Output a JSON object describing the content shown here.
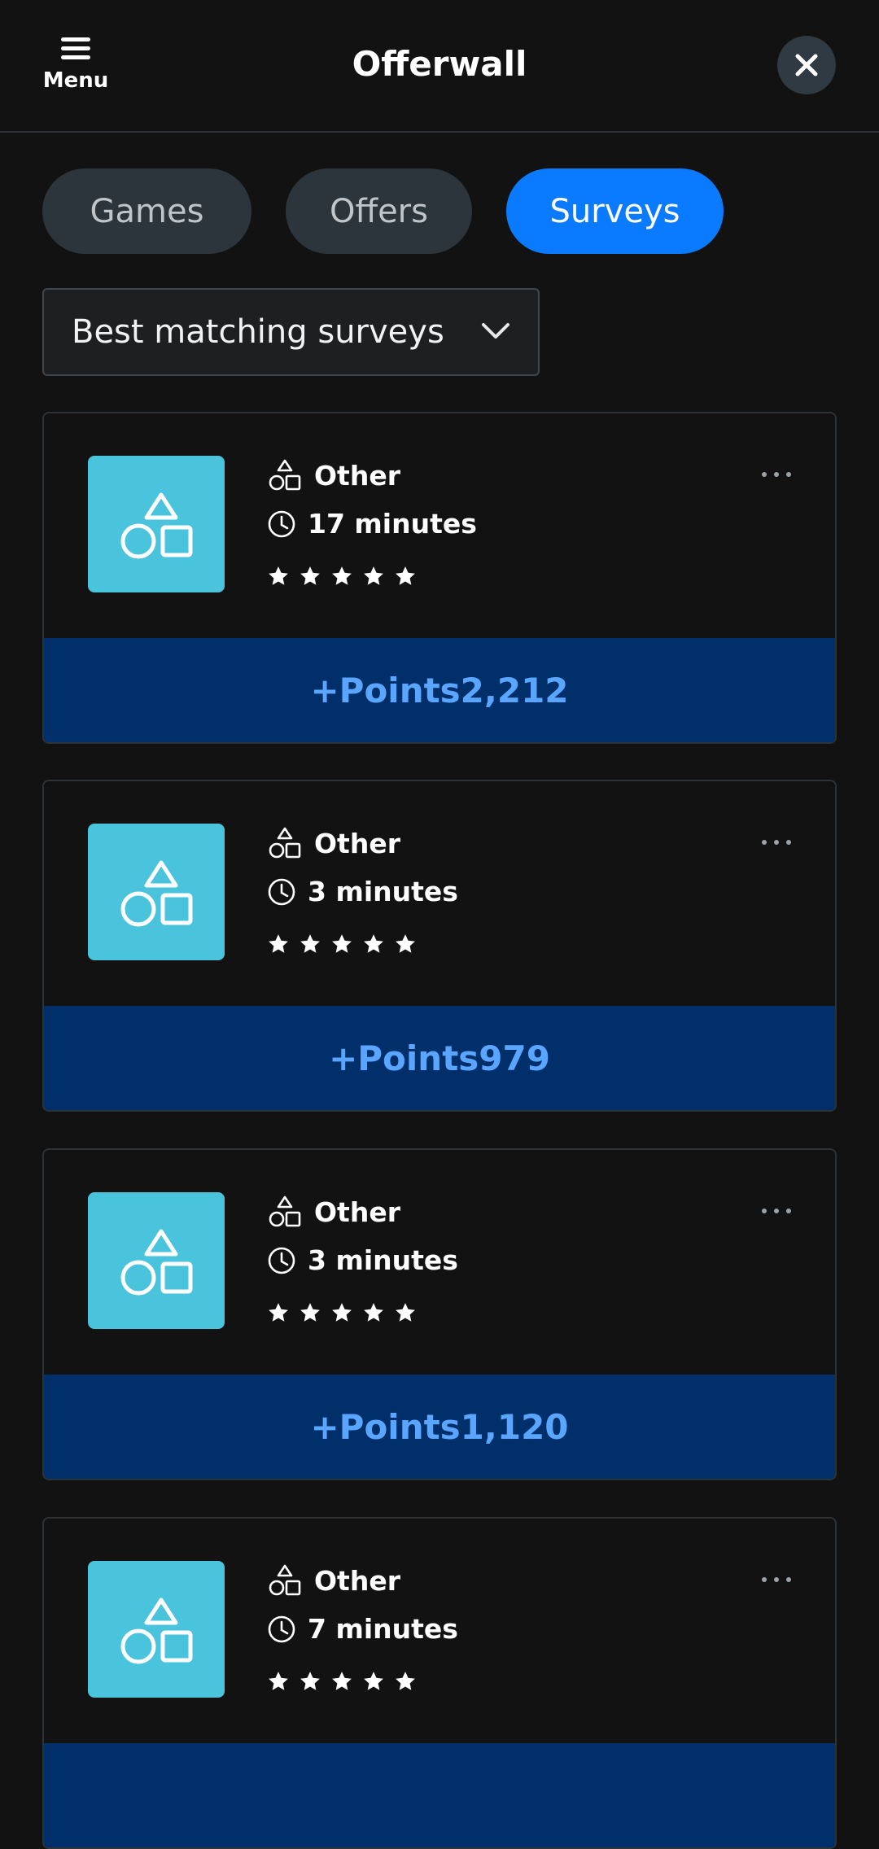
{
  "header": {
    "menu_label": "Menu",
    "title": "Offerwall"
  },
  "tabs": [
    {
      "label": "Games",
      "active": false
    },
    {
      "label": "Offers",
      "active": false
    },
    {
      "label": "Surveys",
      "active": true
    }
  ],
  "filter": {
    "selected": "Best matching surveys"
  },
  "surveys": [
    {
      "category": "Other",
      "duration": "17 minutes",
      "rating": 5,
      "points_label": "+Points2,212"
    },
    {
      "category": "Other",
      "duration": "3 minutes",
      "rating": 5,
      "points_label": "+Points979"
    },
    {
      "category": "Other",
      "duration": "3 minutes",
      "rating": 5,
      "points_label": "+Points1,120"
    },
    {
      "category": "Other",
      "duration": "7 minutes",
      "rating": 5,
      "points_label": ""
    }
  ],
  "colors": {
    "accent": "#0a7aff",
    "thumb": "#4ac3dd",
    "points_bg": "#002f6a",
    "points_text": "#5aa5ff",
    "background": "#121212"
  }
}
